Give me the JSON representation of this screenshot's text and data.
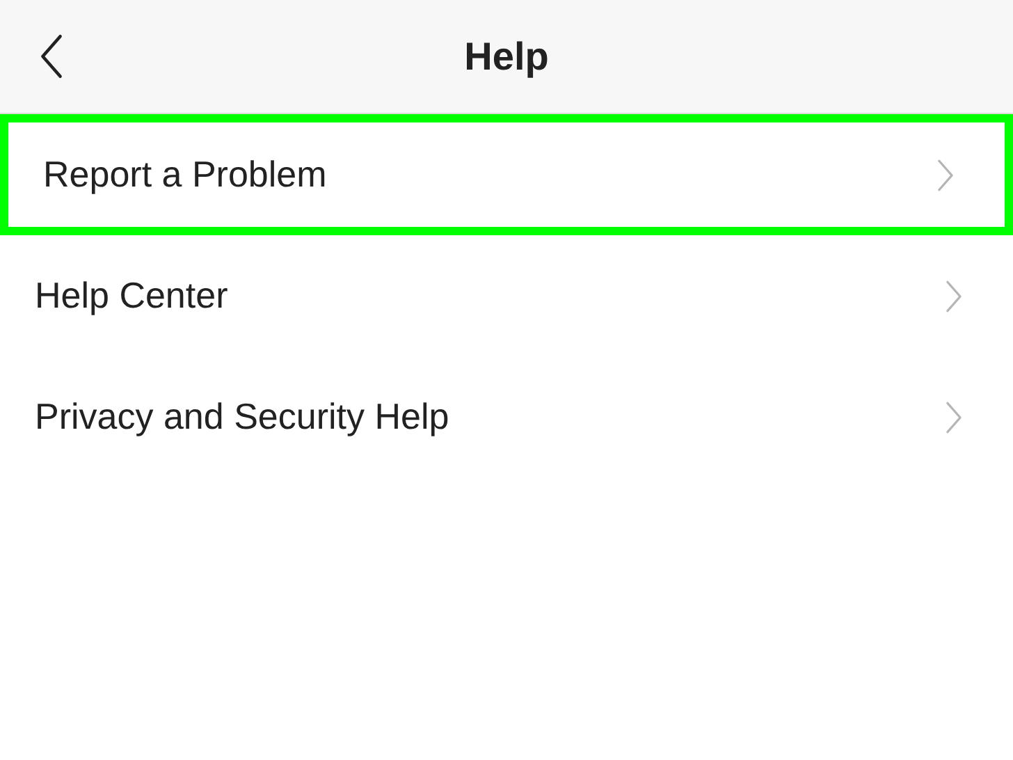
{
  "header": {
    "title": "Help"
  },
  "items": [
    {
      "label": "Report a Problem",
      "highlighted": true
    },
    {
      "label": "Help Center",
      "highlighted": false
    },
    {
      "label": "Privacy and Security Help",
      "highlighted": false
    }
  ]
}
